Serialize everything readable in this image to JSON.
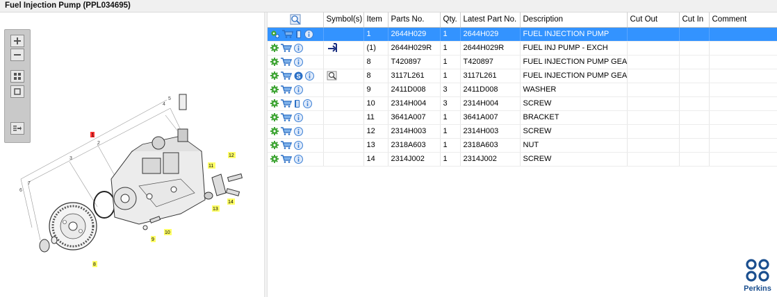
{
  "window": {
    "title": "Fuel Injection Pump (PPL034695)"
  },
  "toolbar": {
    "buttons": [
      "zoom-in",
      "zoom-out",
      "fit-all",
      "reset-view",
      "sync-parts"
    ]
  },
  "table": {
    "columns": [
      "",
      "Symbol(s)",
      "Item",
      "Parts No.",
      "Qty.",
      "Latest Part No.",
      "Description",
      "Cut Out",
      "Cut In",
      "Comment"
    ],
    "rows": [
      {
        "item": "1",
        "part_no": "2644H029",
        "qty": "1",
        "latest": "2644H029",
        "description": "FUEL INJECTION PUMP",
        "cut_out": "",
        "cut_in": "",
        "comment": "",
        "selected": true,
        "icons": [
          "gear-add",
          "cart",
          "book",
          "info"
        ],
        "symbol": ""
      },
      {
        "item": "(1)",
        "part_no": "2644H029R",
        "qty": "1",
        "latest": "2644H029R",
        "description": "FUEL INJ PUMP - EXCH",
        "cut_out": "",
        "cut_in": "",
        "comment": "",
        "selected": false,
        "icons": [
          "gear",
          "cart",
          "info"
        ],
        "symbol": "exchange-arrow"
      },
      {
        "item": "8",
        "part_no": "T420897",
        "qty": "1",
        "latest": "T420897",
        "description": "FUEL INJECTION PUMP GEAR",
        "cut_out": "",
        "cut_in": "",
        "comment": "",
        "selected": false,
        "icons": [
          "gear",
          "cart",
          "info"
        ],
        "symbol": ""
      },
      {
        "item": "8",
        "part_no": "3117L261",
        "qty": "1",
        "latest": "3117L261",
        "description": "FUEL INJECTION PUMP GEAR",
        "cut_out": "",
        "cut_in": "",
        "comment": "",
        "selected": false,
        "icons": [
          "gear",
          "cart",
          "service",
          "info"
        ],
        "symbol": "zoom-picture"
      },
      {
        "item": "9",
        "part_no": "2411D008",
        "qty": "3",
        "latest": "2411D008",
        "description": "WASHER",
        "cut_out": "",
        "cut_in": "",
        "comment": "",
        "selected": false,
        "icons": [
          "gear",
          "cart",
          "info"
        ],
        "symbol": ""
      },
      {
        "item": "10",
        "part_no": "2314H004",
        "qty": "3",
        "latest": "2314H004",
        "description": "SCREW",
        "cut_out": "",
        "cut_in": "",
        "comment": "",
        "selected": false,
        "icons": [
          "gear",
          "cart",
          "book",
          "info"
        ],
        "symbol": ""
      },
      {
        "item": "11",
        "part_no": "3641A007",
        "qty": "1",
        "latest": "3641A007",
        "description": "BRACKET",
        "cut_out": "",
        "cut_in": "",
        "comment": "",
        "selected": false,
        "icons": [
          "gear",
          "cart",
          "info"
        ],
        "symbol": ""
      },
      {
        "item": "12",
        "part_no": "2314H003",
        "qty": "1",
        "latest": "2314H003",
        "description": "SCREW",
        "cut_out": "",
        "cut_in": "",
        "comment": "",
        "selected": false,
        "icons": [
          "gear",
          "cart",
          "info"
        ],
        "symbol": ""
      },
      {
        "item": "13",
        "part_no": "2318A603",
        "qty": "1",
        "latest": "2318A603",
        "description": "NUT",
        "cut_out": "",
        "cut_in": "",
        "comment": "",
        "selected": false,
        "icons": [
          "gear",
          "cart",
          "info"
        ],
        "symbol": ""
      },
      {
        "item": "14",
        "part_no": "2314J002",
        "qty": "1",
        "latest": "2314J002",
        "description": "SCREW",
        "cut_out": "",
        "cut_in": "",
        "comment": "",
        "selected": false,
        "icons": [
          "gear",
          "cart",
          "info"
        ],
        "symbol": ""
      }
    ]
  },
  "drawing": {
    "callouts": [
      {
        "label": "1",
        "style": "red"
      },
      {
        "label": "2",
        "style": "plain"
      },
      {
        "label": "3",
        "style": "plain"
      },
      {
        "label": "4",
        "style": "plain"
      },
      {
        "label": "5",
        "style": "plain"
      },
      {
        "label": "6",
        "style": "plain"
      },
      {
        "label": "7",
        "style": "plain"
      },
      {
        "label": "8",
        "style": "yellow"
      },
      {
        "label": "9",
        "style": "yellow"
      },
      {
        "label": "10",
        "style": "yellow"
      },
      {
        "label": "11",
        "style": "yellow"
      },
      {
        "label": "12",
        "style": "yellow"
      },
      {
        "label": "13",
        "style": "yellow"
      },
      {
        "label": "14",
        "style": "yellow"
      }
    ]
  },
  "brand": {
    "name": "Perkins",
    "color": "#1b4f8f"
  },
  "colors": {
    "selection": "#3393ff",
    "gear_green": "#3fa535",
    "cart_blue": "#2a6fc6",
    "info_blue": "#3a7fd5",
    "callout_yellow": "#ffff66",
    "callout_red": "#ff3333"
  }
}
